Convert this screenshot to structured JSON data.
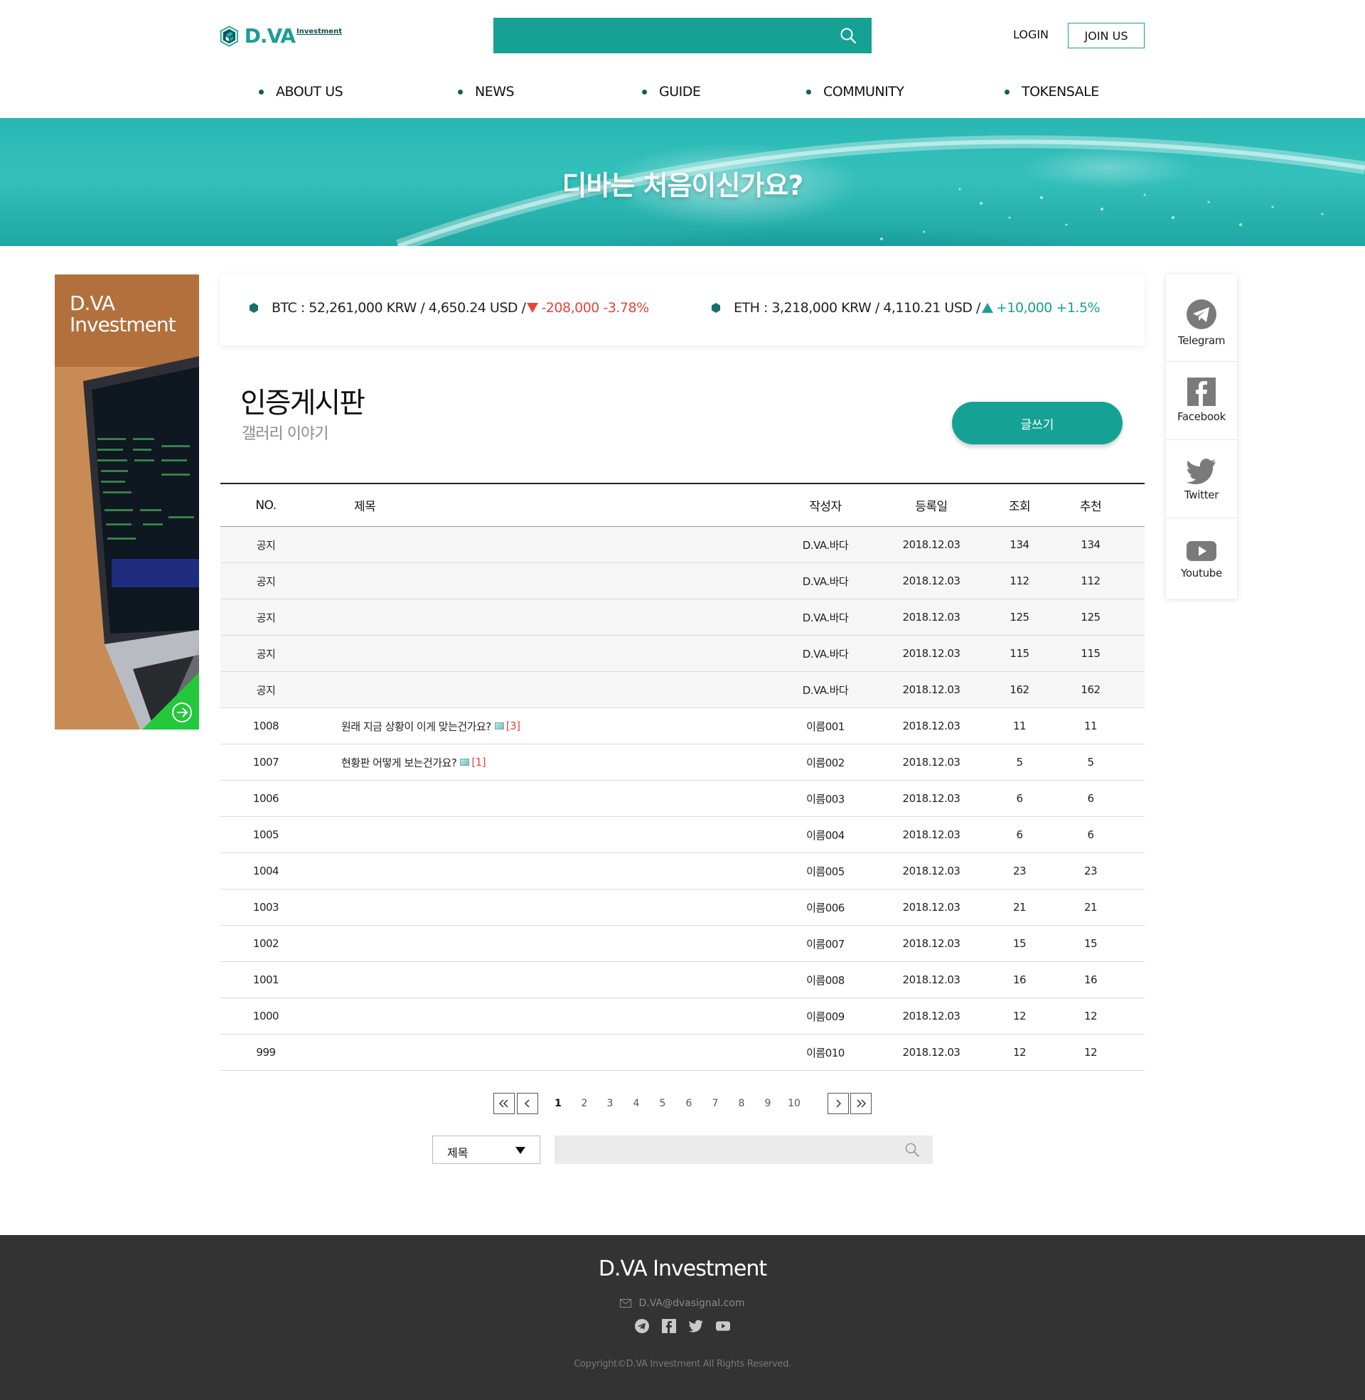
{
  "header": {
    "logo_main": "D.VA",
    "logo_sub": "Investment",
    "search_placeholder": "",
    "login_label": "LOGIN",
    "join_label": "JOIN US",
    "nav": [
      "ABOUT US",
      "NEWS",
      "GUIDE",
      "COMMUNITY",
      "TOKENSALE"
    ]
  },
  "banner": {
    "title": "디바는 처음이신가요?"
  },
  "ad": {
    "line1": "D.VA",
    "line2": "Investment",
    "accent_color": "#22c93a"
  },
  "ticker": {
    "btc": {
      "text": "BTC : 52,261,000 KRW / 4,650.24 USD /",
      "change": "-208,000 -3.78%",
      "direction": "down"
    },
    "eth": {
      "text": "ETH : 3,218,000 KRW / 4,110.21 USD /",
      "change": "+10,000 +1.5%",
      "direction": "up"
    }
  },
  "board": {
    "title": "인증게시판",
    "subtitle": "갤러리 이야기",
    "write_label": "글쓰기",
    "columns": [
      "NO.",
      "제목",
      "작성자",
      "등록일",
      "조회",
      "추천"
    ],
    "rows": [
      {
        "no": "공지",
        "title": "",
        "has_image": false,
        "comments": "",
        "author": "D.VA.바다",
        "date": "2018.12.03",
        "views": "134",
        "rec": "134",
        "notice": true
      },
      {
        "no": "공지",
        "title": "",
        "has_image": false,
        "comments": "",
        "author": "D.VA.바다",
        "date": "2018.12.03",
        "views": "112",
        "rec": "112",
        "notice": true
      },
      {
        "no": "공지",
        "title": "",
        "has_image": false,
        "comments": "",
        "author": "D.VA.바다",
        "date": "2018.12.03",
        "views": "125",
        "rec": "125",
        "notice": true
      },
      {
        "no": "공지",
        "title": "",
        "has_image": false,
        "comments": "",
        "author": "D.VA.바다",
        "date": "2018.12.03",
        "views": "115",
        "rec": "115",
        "notice": true
      },
      {
        "no": "공지",
        "title": "",
        "has_image": false,
        "comments": "",
        "author": "D.VA.바다",
        "date": "2018.12.03",
        "views": "162",
        "rec": "162",
        "notice": true
      },
      {
        "no": "1008",
        "title": "원래 지금 상황이 이게 맞는건가요?",
        "has_image": true,
        "comments": "[3]",
        "author": "이름001",
        "date": "2018.12.03",
        "views": "11",
        "rec": "11",
        "notice": false
      },
      {
        "no": "1007",
        "title": "현황판 어떻게 보는건가요?",
        "has_image": true,
        "comments": "[1]",
        "author": "이름002",
        "date": "2018.12.03",
        "views": "5",
        "rec": "5",
        "notice": false
      },
      {
        "no": "1006",
        "title": "",
        "has_image": false,
        "comments": "",
        "author": "이름003",
        "date": "2018.12.03",
        "views": "6",
        "rec": "6",
        "notice": false
      },
      {
        "no": "1005",
        "title": "",
        "has_image": false,
        "comments": "",
        "author": "이름004",
        "date": "2018.12.03",
        "views": "6",
        "rec": "6",
        "notice": false
      },
      {
        "no": "1004",
        "title": "",
        "has_image": false,
        "comments": "",
        "author": "이름005",
        "date": "2018.12.03",
        "views": "23",
        "rec": "23",
        "notice": false
      },
      {
        "no": "1003",
        "title": "",
        "has_image": false,
        "comments": "",
        "author": "이름006",
        "date": "2018.12.03",
        "views": "21",
        "rec": "21",
        "notice": false
      },
      {
        "no": "1002",
        "title": "",
        "has_image": false,
        "comments": "",
        "author": "이름007",
        "date": "2018.12.03",
        "views": "15",
        "rec": "15",
        "notice": false
      },
      {
        "no": "1001",
        "title": "",
        "has_image": false,
        "comments": "",
        "author": "이름008",
        "date": "2018.12.03",
        "views": "16",
        "rec": "16",
        "notice": false
      },
      {
        "no": "1000",
        "title": "",
        "has_image": false,
        "comments": "",
        "author": "이름009",
        "date": "2018.12.03",
        "views": "12",
        "rec": "12",
        "notice": false
      },
      {
        "no": "999",
        "title": "",
        "has_image": false,
        "comments": "",
        "author": "이름010",
        "date": "2018.12.03",
        "views": "12",
        "rec": "12",
        "notice": false
      }
    ]
  },
  "pagination": {
    "pages": [
      "1",
      "2",
      "3",
      "4",
      "5",
      "6",
      "7",
      "8",
      "9",
      "10"
    ],
    "current": "1"
  },
  "board_search": {
    "select_value": "제목",
    "placeholder": ""
  },
  "sns": [
    {
      "label": "Telegram",
      "icon": "telegram-icon"
    },
    {
      "label": "Facebook",
      "icon": "facebook-icon"
    },
    {
      "label": "Twitter",
      "icon": "twitter-icon"
    },
    {
      "label": "Youtube",
      "icon": "youtube-icon"
    }
  ],
  "footer": {
    "brand": "D.VA Investment",
    "email": "D.VA@dvasignal.com",
    "copyright": "Copyright©D.VA Investment All Rights Reserved."
  },
  "colors": {
    "primary": "#16a195",
    "down": "#e8443a",
    "footer_bg": "#333333"
  }
}
